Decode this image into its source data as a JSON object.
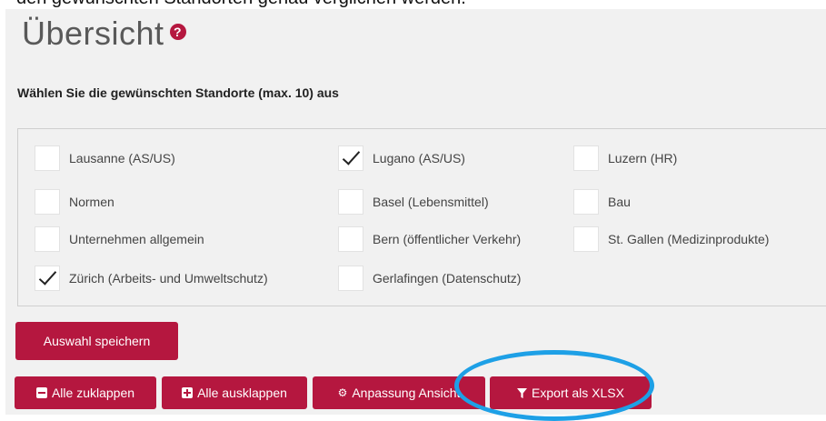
{
  "top_text": "den gewünschten Standorten genau verglichen werden.",
  "title": "Übersicht",
  "help_glyph": "?",
  "subtitle": "Wählen Sie die gewünschten Standorte (max. 10) aus",
  "locations": [
    {
      "label": "Lausanne (AS/US)",
      "checked": false
    },
    {
      "label": "Lugano (AS/US)",
      "checked": true
    },
    {
      "label": "Luzern (HR)",
      "checked": false
    },
    {
      "label": "Normen",
      "checked": false
    },
    {
      "label": "Basel (Lebensmittel)",
      "checked": false
    },
    {
      "label": "Bau",
      "checked": false
    },
    {
      "label": "Unternehmen allgemein",
      "checked": false
    },
    {
      "label": "Bern (öffentlicher Verkehr)",
      "checked": false
    },
    {
      "label": "St. Gallen (Medizinprodukte)",
      "checked": false
    },
    {
      "label": "Zürich (Arbeits- und Umweltschutz)",
      "checked": true
    },
    {
      "label": "Gerlafingen (Datenschutz)",
      "checked": false
    }
  ],
  "buttons": {
    "save": "Auswahl speichern",
    "collapse_all": "Alle zuklappen",
    "expand_all": "Alle ausklappen",
    "view_settings": "Anpassung Ansicht",
    "export_xlsx": "Export als XLSX"
  },
  "colors": {
    "accent": "#b5173f",
    "highlight_ellipse": "#1ea0e6",
    "panel_background": "#f1f1f1"
  }
}
